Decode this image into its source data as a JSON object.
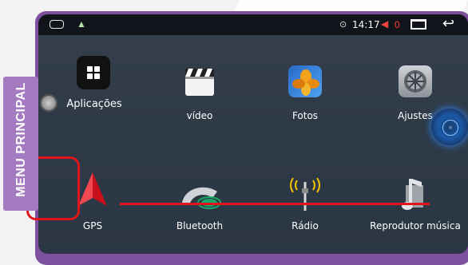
{
  "side_tab": {
    "label": "MENU PRINCIPAL"
  },
  "status_bar": {
    "time": "14:17",
    "badge": "0"
  },
  "apps": [
    {
      "label": "Aplicações",
      "icon": "apps-grid-icon"
    },
    {
      "label": "vídeo",
      "icon": "video-clapper-icon"
    },
    {
      "label": "Fotos",
      "icon": "photos-icon"
    },
    {
      "label": "Ajustes",
      "icon": "settings-icon"
    },
    {
      "label": "GPS",
      "icon": "gps-arrow-icon"
    },
    {
      "label": "Bluetooth",
      "icon": "phone-handset-icon"
    },
    {
      "label": "Rádio",
      "icon": "radio-antenna-icon"
    },
    {
      "label": "Reprodutor música",
      "icon": "music-note-icon"
    }
  ],
  "colors": {
    "accent_red": "#e0141c",
    "tab_purple": "#a47ac0",
    "frame_purple": "#7d4f9c"
  }
}
